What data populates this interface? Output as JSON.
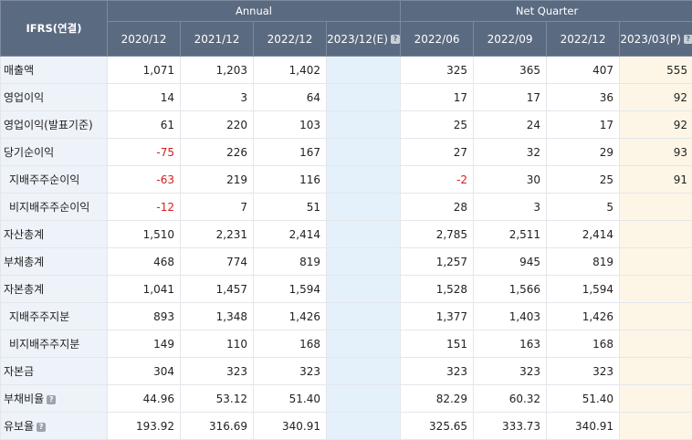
{
  "header": {
    "corner_label": "IFRS(연결)",
    "group_annual": "Annual",
    "group_quarter": "Net Quarter",
    "periods": [
      "2020/12",
      "2021/12",
      "2022/12",
      "2023/12(E)",
      "2022/06",
      "2022/09",
      "2022/12",
      "2023/03(P)"
    ]
  },
  "rows": [
    {
      "label": "매출액",
      "indent": false,
      "info": false,
      "values": [
        "1,071",
        "1,203",
        "1,402",
        "",
        "325",
        "365",
        "407",
        "555"
      ]
    },
    {
      "label": "영업이익",
      "indent": false,
      "info": false,
      "values": [
        "14",
        "3",
        "64",
        "",
        "17",
        "17",
        "36",
        "92"
      ]
    },
    {
      "label": "영업이익(발표기준)",
      "indent": false,
      "info": false,
      "values": [
        "61",
        "220",
        "103",
        "",
        "25",
        "24",
        "17",
        "92"
      ]
    },
    {
      "label": "당기순이익",
      "indent": false,
      "info": false,
      "values": [
        "-75",
        "226",
        "167",
        "",
        "27",
        "32",
        "29",
        "93"
      ]
    },
    {
      "label": "지배주주순이익",
      "indent": true,
      "info": false,
      "values": [
        "-63",
        "219",
        "116",
        "",
        "-2",
        "30",
        "25",
        "91"
      ]
    },
    {
      "label": "비지배주주순이익",
      "indent": true,
      "info": false,
      "values": [
        "-12",
        "7",
        "51",
        "",
        "28",
        "3",
        "5",
        ""
      ]
    },
    {
      "label": "자산총계",
      "indent": false,
      "info": false,
      "values": [
        "1,510",
        "2,231",
        "2,414",
        "",
        "2,785",
        "2,511",
        "2,414",
        ""
      ]
    },
    {
      "label": "부채총계",
      "indent": false,
      "info": false,
      "values": [
        "468",
        "774",
        "819",
        "",
        "1,257",
        "945",
        "819",
        ""
      ]
    },
    {
      "label": "자본총계",
      "indent": false,
      "info": false,
      "values": [
        "1,041",
        "1,457",
        "1,594",
        "",
        "1,528",
        "1,566",
        "1,594",
        ""
      ]
    },
    {
      "label": "지배주주지분",
      "indent": true,
      "info": false,
      "values": [
        "893",
        "1,348",
        "1,426",
        "",
        "1,377",
        "1,403",
        "1,426",
        ""
      ]
    },
    {
      "label": "비지배주주지분",
      "indent": true,
      "info": false,
      "values": [
        "149",
        "110",
        "168",
        "",
        "151",
        "163",
        "168",
        ""
      ]
    },
    {
      "label": "자본금",
      "indent": false,
      "info": false,
      "values": [
        "304",
        "323",
        "323",
        "",
        "323",
        "323",
        "323",
        ""
      ]
    },
    {
      "label": "부채비율",
      "indent": false,
      "info": true,
      "values": [
        "44.96",
        "53.12",
        "51.40",
        "",
        "82.29",
        "60.32",
        "51.40",
        ""
      ]
    },
    {
      "label": "유보율",
      "indent": false,
      "info": true,
      "values": [
        "193.92",
        "316.69",
        "340.91",
        "",
        "325.65",
        "333.73",
        "340.91",
        ""
      ]
    }
  ],
  "info_glyph": "?",
  "colors": {
    "header_bg": "#5a6a80",
    "label_bg": "#eef3f9",
    "estimate_bg": "#e4f1fb",
    "provisional_bg": "#fdf6e6",
    "negative": "#d21e1e"
  }
}
